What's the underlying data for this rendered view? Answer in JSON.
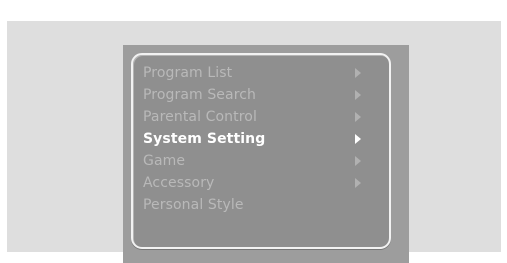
{
  "menu": {
    "items": [
      {
        "label": "Program List",
        "has_submenu": true,
        "selected": false
      },
      {
        "label": "Program Search",
        "has_submenu": true,
        "selected": false
      },
      {
        "label": "Parental Control",
        "has_submenu": true,
        "selected": false
      },
      {
        "label": "System Setting",
        "has_submenu": true,
        "selected": true
      },
      {
        "label": "Game",
        "has_submenu": true,
        "selected": false
      },
      {
        "label": "Accessory",
        "has_submenu": true,
        "selected": false
      },
      {
        "label": "Personal Style",
        "has_submenu": false,
        "selected": false
      }
    ]
  },
  "colors": {
    "screen_background": "#dedede",
    "menu_frame": "#9d9d9d",
    "menu_panel": "#8f8f8f",
    "item_text": "#b9b9b9",
    "selected_text": "#ffffff",
    "panel_border": "#f2f2f2"
  }
}
